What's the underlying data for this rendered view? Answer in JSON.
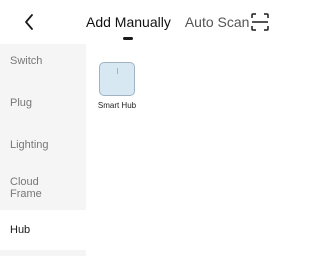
{
  "header": {
    "back_icon": "chevron-left-icon",
    "tabs": [
      {
        "label": "Add Manually",
        "active": true
      },
      {
        "label": "Auto Scan",
        "active": false
      }
    ],
    "scan_icon": "scan-frame-icon"
  },
  "sidebar": {
    "items": [
      {
        "label": "Switch",
        "active": false
      },
      {
        "label": "Plug",
        "active": false
      },
      {
        "label": "Lighting",
        "active": false
      },
      {
        "label": "Cloud Frame",
        "active": false
      },
      {
        "label": "Hub",
        "active": true
      }
    ]
  },
  "devices": [
    {
      "label": "Smart Hub",
      "icon": "smart-hub-icon"
    }
  ],
  "colors": {
    "sidebar_bg": "#f5f5f6",
    "device_icon_bg": "#d8e8f2",
    "text_primary": "#1a1a1a",
    "text_muted": "#777777"
  }
}
